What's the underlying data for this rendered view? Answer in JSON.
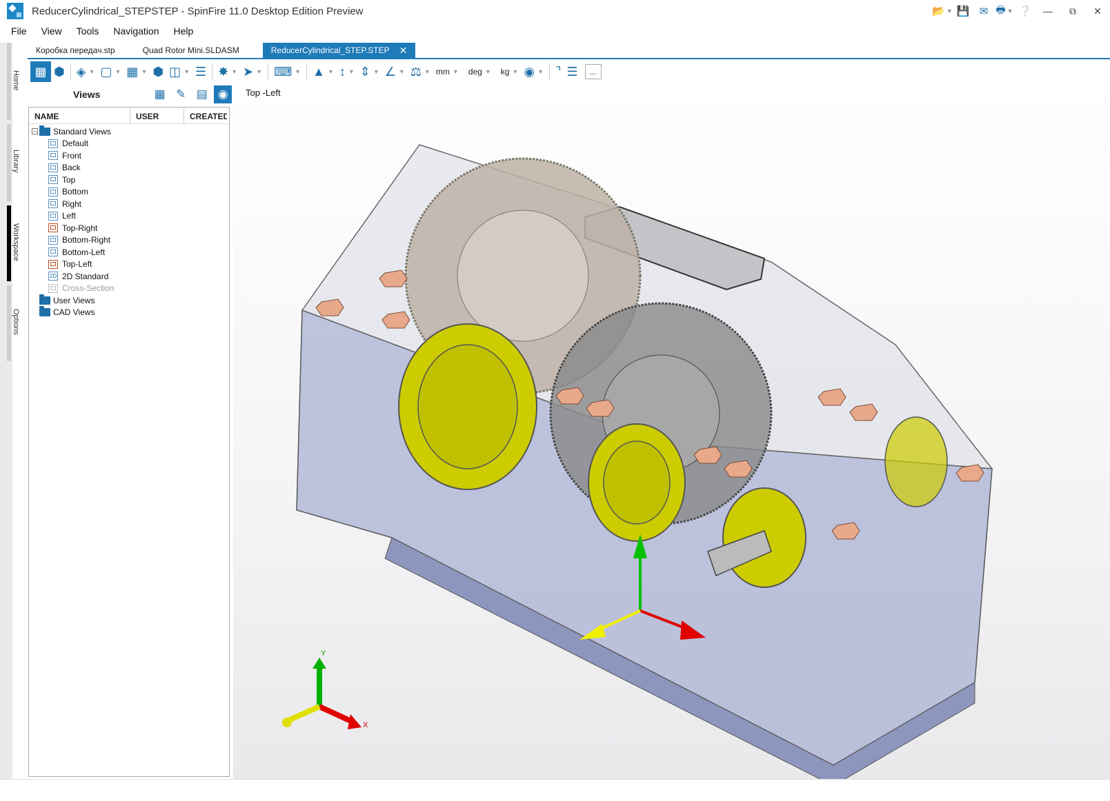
{
  "window": {
    "title": "ReducerCylindrical_STEPSTEP - SpinFire 11.0 Desktop Edition Preview",
    "icons": [
      "open-icon",
      "save-icon",
      "mail-icon",
      "print-icon",
      "help-icon"
    ],
    "controls": [
      "minimize",
      "restore",
      "close"
    ]
  },
  "menu": [
    "File",
    "View",
    "Tools",
    "Navigation",
    "Help"
  ],
  "doc_tabs": [
    "Коробка передач.stp",
    "Quad Rotor Mini.SLDASM",
    "ReducerCylindrical_STEP.STEP"
  ],
  "side_tabs": [
    "Home",
    "Library",
    "Workspace",
    "Options"
  ],
  "toolbar": {
    "units": {
      "length": "mm",
      "angle": "deg",
      "mass": "kg"
    },
    "more": "..."
  },
  "panel": {
    "title": "Views",
    "columns": [
      "NAME",
      "USER",
      "CREATED"
    ],
    "tree": {
      "standard_label": "Standard Views",
      "standard": [
        "Default",
        "Front",
        "Back",
        "Top",
        "Bottom",
        "Right",
        "Left",
        "Top-Right",
        "Bottom-Right",
        "Bottom-Left",
        "Top-Left",
        "2D Standard",
        "Cross-Section"
      ],
      "user_label": "User Views",
      "cad_label": "CAD Views"
    }
  },
  "viewport": {
    "view_name": "Top -Left",
    "triad": {
      "y": "Y",
      "x": "X"
    }
  },
  "colors": {
    "accent": "#1e7ab8",
    "icon": "#1d6fa8",
    "housing": "#aab2d3",
    "cover": "#cccc00",
    "bolt": "#e8a98b",
    "gear": "#8a8a8a"
  }
}
